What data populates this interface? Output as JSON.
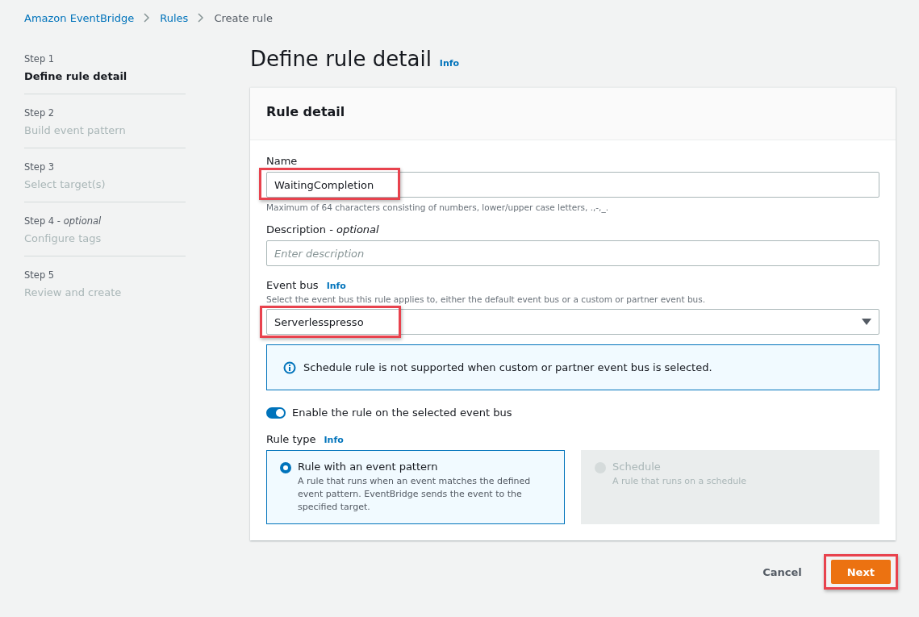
{
  "breadcrumbs": [
    {
      "label": "Amazon EventBridge",
      "kind": "link"
    },
    {
      "label": "Rules",
      "kind": "link"
    },
    {
      "label": "Create rule",
      "kind": "current"
    }
  ],
  "steps": [
    {
      "label": "Step 1",
      "title": "Define rule detail",
      "selected": true
    },
    {
      "label": "Step 2",
      "title": "Build event pattern",
      "selected": false
    },
    {
      "label": "Step 3",
      "title": "Select target(s)",
      "selected": false
    },
    {
      "label": "Step 4 - *optional*",
      "title": "Configure tags",
      "selected": false
    },
    {
      "label": "Step 5",
      "title": "Review and create",
      "selected": false
    }
  ],
  "page_title": "Define rule detail",
  "page_info": "Info",
  "panel": {
    "title": "Rule detail",
    "name": {
      "label": "Name",
      "value": "WaitingCompletion",
      "hint": "Maximum of 64 characters consisting of numbers, lower/upper case letters, .,-,_.",
      "highlighted": true
    },
    "description": {
      "label": "Description - *optional*",
      "placeholder": "Enter description"
    },
    "event_bus": {
      "label": "Event bus",
      "info": "Info",
      "hint": "Select the event bus this rule applies to, either the default event bus or a custom or partner event bus.",
      "value": "Serverlesspresso",
      "highlighted": true
    },
    "alert": "Schedule rule is not supported when custom or partner event bus is selected.",
    "toggle": {
      "label": "Enable the rule on the selected event bus",
      "on": true
    },
    "rule_type": {
      "label": "Rule type",
      "info": "Info",
      "options": [
        {
          "title": "Rule with an event pattern",
          "description": "A rule that runs when an event matches the defined event pattern. EventBridge sends the event to the specified target.",
          "selected": true,
          "disabled": false
        },
        {
          "title": "Schedule",
          "description": "A rule that runs on a schedule",
          "selected": false,
          "disabled": true
        }
      ]
    }
  },
  "actions": {
    "cancel": "Cancel",
    "next": "Next",
    "next_highlighted": true
  }
}
